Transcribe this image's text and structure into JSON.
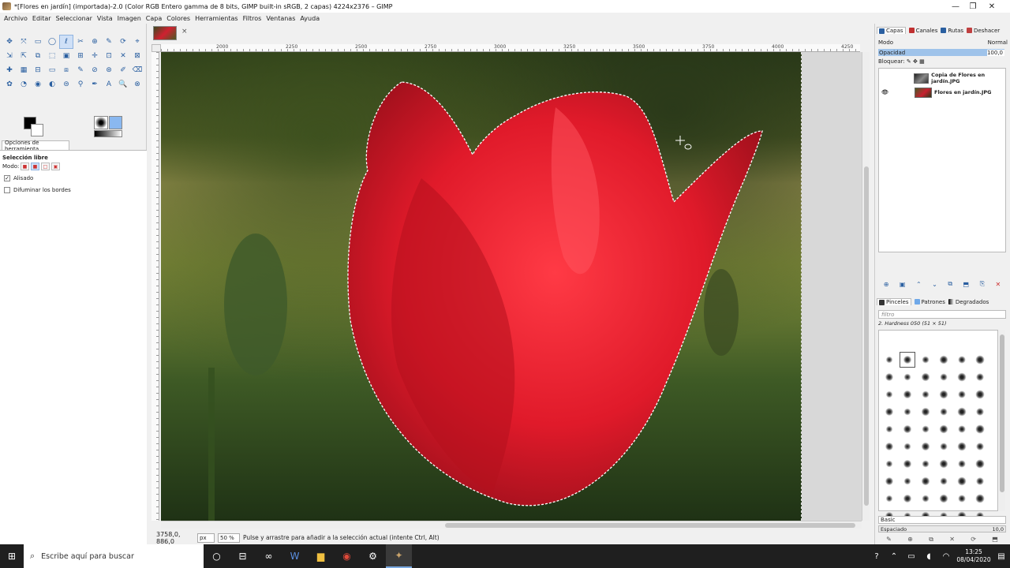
{
  "window": {
    "title": "*[Flores en jardín] (importada)-2.0 (Color RGB Entero gamma de 8 bits, GIMP built-in sRGB, 2 capas) 4224x2376 – GIMP",
    "minimize": "—",
    "maximize": "❐",
    "close": "✕"
  },
  "menu": [
    "Archivo",
    "Editar",
    "Seleccionar",
    "Vista",
    "Imagen",
    "Capa",
    "Colores",
    "Herramientas",
    "Filtros",
    "Ventanas",
    "Ayuda"
  ],
  "toolbox": {
    "tools": [
      "✥",
      "⤧",
      "▭",
      "◯",
      "ℓ",
      "✂",
      "⊕",
      "✎",
      "⟳",
      "⌖",
      "⇲",
      "⇱",
      "⧉",
      "⬚",
      "▣",
      "⊞",
      "✛",
      "⊡",
      "✕",
      "⊠",
      "✚",
      "▦",
      "⊟",
      "▭",
      "⧈",
      "✎",
      "⊘",
      "⊛",
      "✐",
      "⌫",
      "✿",
      "◔",
      "◉",
      "◐",
      "⊜",
      "⚲",
      "✒",
      "A",
      "🔍",
      "⊗"
    ],
    "selected_index": 4,
    "tab_label": "Opciones de herramienta",
    "title": "Selección libre",
    "mode_label": "Modo:",
    "antialias_label": "Alisado",
    "feather_label": "Difuminar los bordes",
    "bottom_icons": [
      "⇪",
      "↺",
      "✕",
      "⟲"
    ]
  },
  "image_tab": {
    "close": "×"
  },
  "ruler": {
    "ticks": [
      "2000",
      "2250",
      "2500",
      "2750",
      "3000",
      "3250",
      "3500",
      "3750",
      "4000",
      "4250"
    ]
  },
  "status": {
    "coords": "3758,0, 886,0",
    "unit": "px",
    "zoom": "50 %",
    "message": "Pulse y arrastre para añadir a la selección actual (intente Ctrl, Alt)"
  },
  "layers_dock": {
    "tabs": [
      "Capas",
      "Canales",
      "Rutas",
      "Deshacer"
    ],
    "tab_colors": [
      "#2a5fa0",
      "#c03030",
      "#2a5fa0",
      "#c04040"
    ],
    "mode_label": "Modo",
    "mode_value": "Normal",
    "opacity_label": "Opacidad",
    "opacity_value": "100,0",
    "lock_label": "Bloquear:",
    "layers": [
      {
        "name": "Copia de Flores en jardín.JPG",
        "visible": false
      },
      {
        "name": "Flores en jardín.JPG",
        "visible": true
      }
    ],
    "bottom_icons": [
      "⊕",
      "▣",
      "⌃",
      "⌄",
      "⧉",
      "⬒",
      "⎘",
      "✕"
    ]
  },
  "brushes_dock": {
    "tabs": [
      "Pinceles",
      "Patrones",
      "Degradados"
    ],
    "filter_placeholder": "filtro",
    "brush_name": "2. Hardness 050 (51 × 51)",
    "set_value": "Basic",
    "spacing_label": "Espaciado",
    "spacing_value": "10,0",
    "bottom_icons": [
      "✎",
      "⊕",
      "⧉",
      "✕",
      "⟳",
      "⬒"
    ]
  },
  "taskbar": {
    "search_placeholder": "Escribe aquí para buscar",
    "time": "13:25",
    "date": "08/04/2020",
    "apps": [
      "○",
      "⊟",
      "∞",
      "W",
      "▆",
      "◉",
      "⚙",
      "✦"
    ]
  },
  "colors": {
    "accent": "#2a5fa0",
    "selection_highlight": "#9fc3ea",
    "tulip_red": "#e8202e"
  }
}
